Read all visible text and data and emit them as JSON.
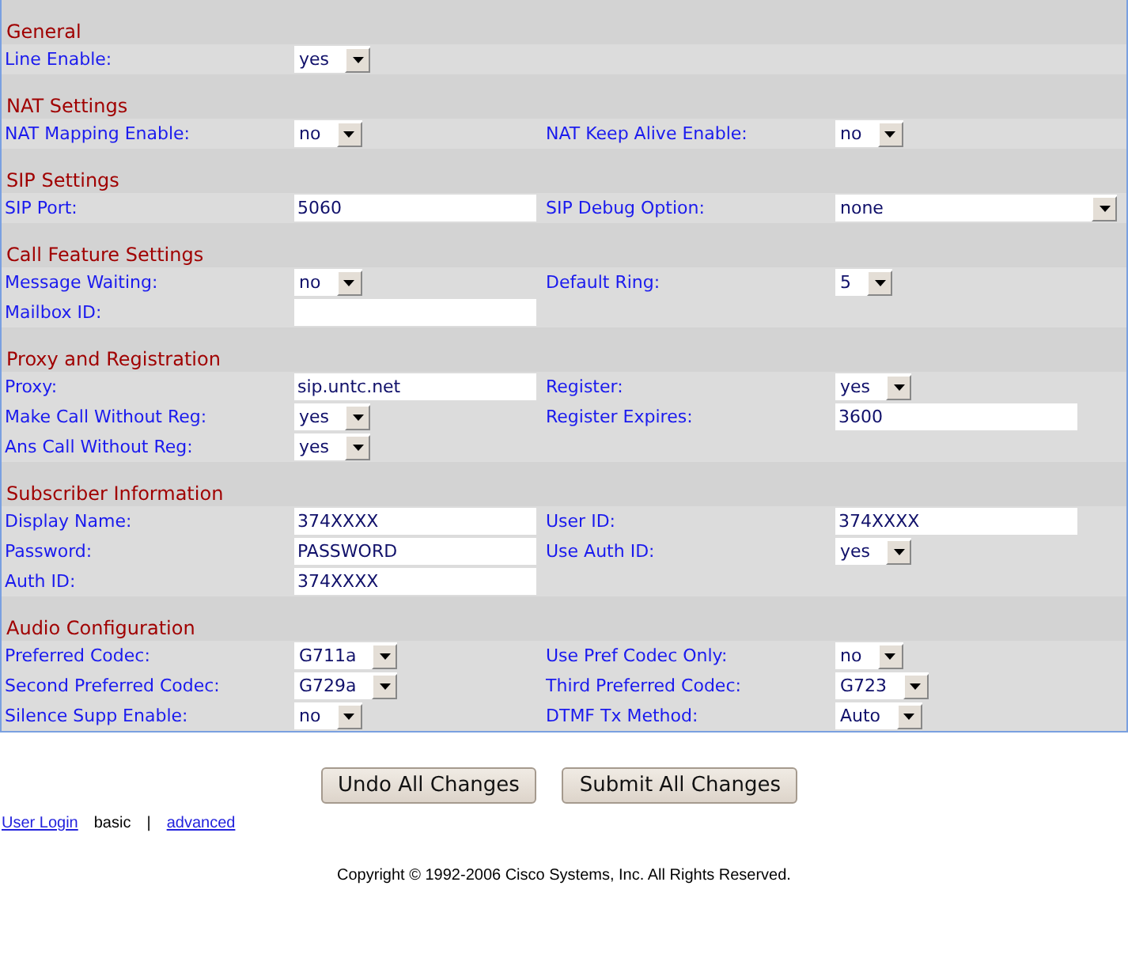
{
  "sections": [
    {
      "title": "General",
      "rows": [
        [
          {
            "label": "Line Enable:",
            "kind": "select",
            "value": "yes"
          }
        ]
      ]
    },
    {
      "title": "NAT Settings",
      "rows": [
        [
          {
            "label": "NAT Mapping Enable:",
            "kind": "select",
            "value": "no"
          },
          {
            "label": "NAT Keep Alive Enable:",
            "kind": "select",
            "value": "no"
          }
        ]
      ]
    },
    {
      "title": "SIP Settings",
      "rows": [
        [
          {
            "label": "SIP Port:",
            "kind": "text",
            "value": "5060"
          },
          {
            "label": "SIP Debug Option:",
            "kind": "wideselect",
            "value": "none"
          }
        ]
      ]
    },
    {
      "title": "Call Feature Settings",
      "rows": [
        [
          {
            "label": "Message Waiting:",
            "kind": "select",
            "value": "no"
          },
          {
            "label": "Default Ring:",
            "kind": "select",
            "value": "5"
          }
        ],
        [
          {
            "label": "Mailbox ID:",
            "kind": "text"
          }
        ]
      ]
    },
    {
      "title": "Proxy and Registration",
      "rows": [
        [
          {
            "label": "Proxy:",
            "kind": "text",
            "value": "sip.untc.net"
          },
          {
            "label": "Register:",
            "kind": "select",
            "value": "yes"
          }
        ],
        [
          {
            "label": "Make Call Without Reg:",
            "kind": "select",
            "value": "yes"
          },
          {
            "label": "Register Expires:",
            "kind": "text",
            "value": "3600"
          }
        ],
        [
          {
            "label": "Ans Call Without Reg:",
            "kind": "select",
            "value": "yes"
          }
        ]
      ]
    },
    {
      "title": "Subscriber Information",
      "rows": [
        [
          {
            "label": "Display Name:",
            "kind": "text",
            "value": "374XXXX"
          },
          {
            "label": "User ID:",
            "kind": "text",
            "value": "374XXXX"
          }
        ],
        [
          {
            "label": "Password:",
            "kind": "text",
            "value": "PASSWORD"
          },
          {
            "label": "Use Auth ID:",
            "kind": "select",
            "value": "yes"
          }
        ],
        [
          {
            "label": "Auth ID:",
            "kind": "text",
            "value": "374XXXX"
          }
        ]
      ]
    },
    {
      "title": "Audio Configuration",
      "rows": [
        [
          {
            "label": "Preferred Codec:",
            "kind": "select",
            "value": "G711a"
          },
          {
            "label": "Use Pref Codec Only:",
            "kind": "select",
            "value": "no"
          }
        ],
        [
          {
            "label": "Second Preferred Codec:",
            "kind": "select",
            "value": "G729a"
          },
          {
            "label": "Third Preferred Codec:",
            "kind": "select",
            "value": "G723"
          }
        ],
        [
          {
            "label": "Silence Supp Enable:",
            "kind": "select",
            "value": "no"
          },
          {
            "label": "DTMF Tx Method:",
            "kind": "select",
            "value": "Auto"
          }
        ]
      ]
    }
  ],
  "buttons": [
    "Undo All Changes",
    "Submit All Changes"
  ],
  "footer_links": [
    {
      "kind": "link",
      "text": "User Login"
    },
    {
      "kind": "plain",
      "text": "basic"
    },
    {
      "kind": "plain",
      "text": "|"
    },
    {
      "kind": "link",
      "text": "advanced"
    }
  ],
  "copyright": "Copyright © 1992-2006 Cisco Systems, Inc. All Rights Reserved."
}
